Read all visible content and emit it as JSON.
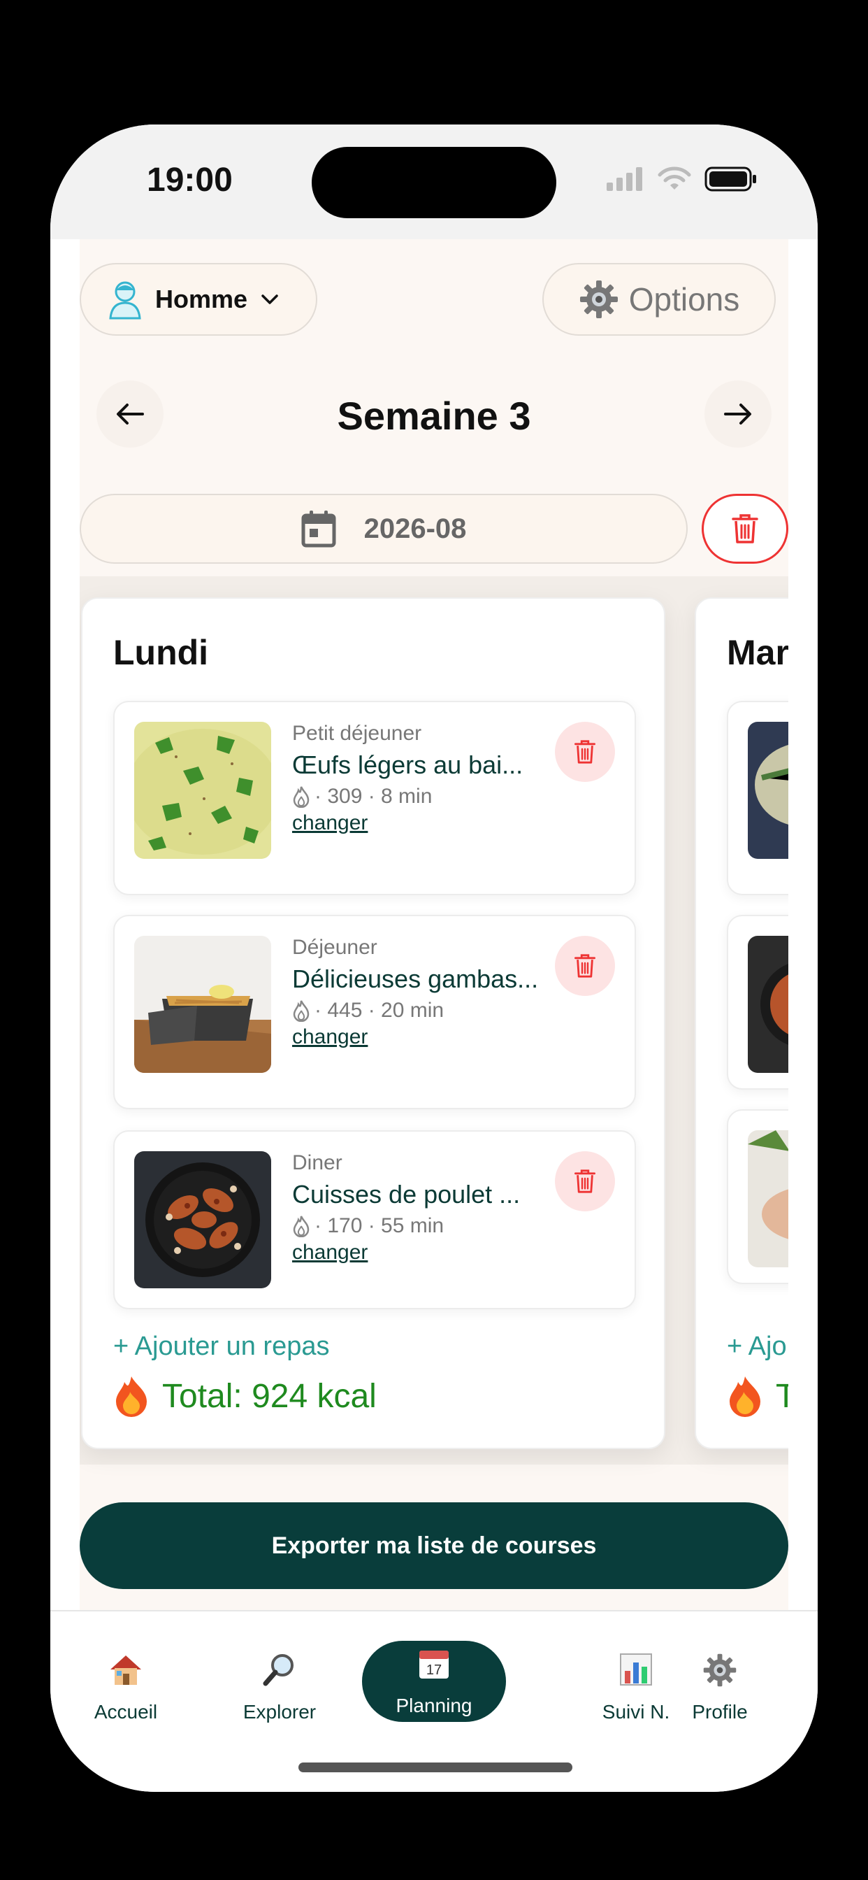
{
  "status": {
    "time": "19:00"
  },
  "header": {
    "gender_label": "Homme",
    "options_label": "Options",
    "week_title": "Semaine 3",
    "date_value": "2026-08"
  },
  "days": [
    {
      "title": "Lundi",
      "meals": [
        {
          "type": "Petit déjeuner",
          "name": "Œufs légers au bai...",
          "meta": "· 309 · 8 min",
          "change": "changer"
        },
        {
          "type": "Déjeuner",
          "name": "Délicieuses gambas...",
          "meta": "· 445 · 20 min",
          "change": "changer"
        },
        {
          "type": "Diner",
          "name": "Cuisses de poulet ...",
          "meta": "· 170 · 55 min",
          "change": "changer"
        }
      ],
      "add_label": "+ Ajouter un repas",
      "total_label": "Total: 924  kcal"
    },
    {
      "title": "Mar",
      "add_label": "+ Ajo",
      "total_label": "T"
    }
  ],
  "export_label": "Exporter ma liste de courses",
  "tabs": [
    {
      "label": "Accueil",
      "icon": "house-icon"
    },
    {
      "label": "Explorer",
      "icon": "magnifier-icon"
    },
    {
      "label": "Planning",
      "icon": "calendar-icon"
    },
    {
      "label": "Suivi N.",
      "icon": "chart-icon"
    },
    {
      "label": "Profile",
      "icon": "gear-icon"
    }
  ],
  "colors": {
    "accent": "#093d3b",
    "danger": "#e33333",
    "link": "#2a9a92",
    "total": "#1f8a1f"
  }
}
